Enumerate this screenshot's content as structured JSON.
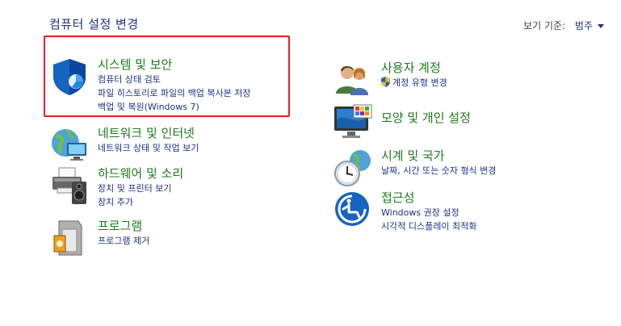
{
  "header": {
    "title": "컴퓨터 설정 변경",
    "viewby_label": "보기 기준:",
    "viewby_value": "범주"
  },
  "categories": {
    "system": {
      "title": "시스템 및 보안",
      "links": [
        "컴퓨터 상태 검토",
        "파일 히스토리로 파일의 백업 복사본 저장",
        "백업 및 복원(Windows 7)"
      ]
    },
    "network": {
      "title": "네트워크 및 인터넷",
      "links": [
        "네트워크 상태 및 작업 보기"
      ]
    },
    "hardware": {
      "title": "하드웨어 및 소리",
      "links": [
        "장치 및 프린터 보기",
        "장치 추가"
      ]
    },
    "programs": {
      "title": "프로그램",
      "links": [
        "프로그램 제거"
      ]
    },
    "users": {
      "title": "사용자 계정",
      "links": [
        "계정 유형 변경"
      ]
    },
    "appearance": {
      "title": "모양 및 개인 설정",
      "links": []
    },
    "clock": {
      "title": "시계 및 국가",
      "links": [
        "날짜, 시간 또는 숫자 형식 변경"
      ]
    },
    "access": {
      "title": "접근성",
      "links": [
        "Windows 권장 설정",
        "시각적 디스플레이 최적화"
      ]
    }
  },
  "colors": {
    "title_green": "#1e7a1e",
    "link_blue": "#1e3287",
    "highlight_red": "#e02020"
  }
}
